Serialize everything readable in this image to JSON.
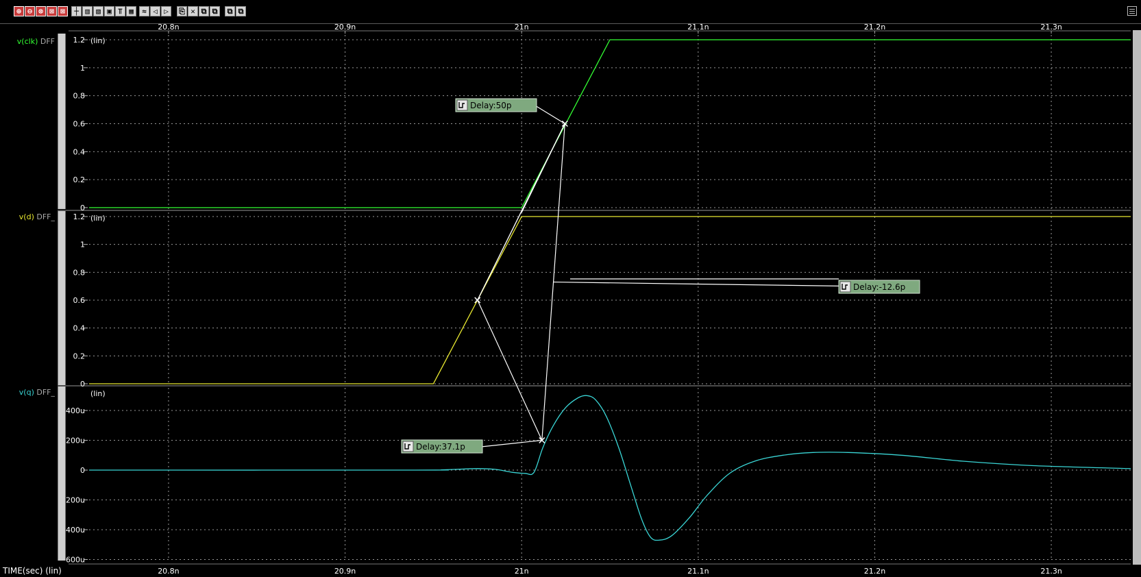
{
  "toolbar": {
    "group1": [
      "⊕",
      "⊖",
      "⊗",
      "⊠",
      "⊠"
    ],
    "group2": [
      "┼",
      "▥",
      "▧",
      "▣",
      "⫪",
      "▦"
    ],
    "group3": [
      "≈",
      "◁",
      "▷"
    ],
    "group4": [
      "⎘",
      "✕",
      "⧉",
      "⧉"
    ],
    "group5": [
      "⧉",
      "⧉"
    ]
  },
  "x_axis_label": "TIME(sec) (lin)",
  "chart_data": {
    "type": "line",
    "x_unit": "s",
    "xlim": [
      2.0755e-08,
      2.1345e-08
    ],
    "x_ticks": [
      2.08e-08,
      2.09e-08,
      2.1e-08,
      2.11e-08,
      2.12e-08,
      2.13e-08
    ],
    "x_tick_labels": [
      "20.8n",
      "20.9n",
      "21n",
      "21.1n",
      "21.2n",
      "21.3n"
    ],
    "panels": [
      {
        "id": "clk",
        "signal_label": "v(clk)",
        "signal_device": "DFF",
        "unit_label": "(lin)",
        "color": "#33ff33",
        "ylim": [
          -0.02,
          1.26
        ],
        "y_ticks": [
          0,
          0.2,
          0.4,
          0.6,
          0.8,
          1,
          1.2
        ],
        "y_tick_labels": [
          "0",
          "0.2",
          "0.4",
          "0.6",
          "0.8",
          "1",
          "1.2"
        ],
        "x": [
          2.0755e-08,
          2.1e-08,
          2.105e-08,
          2.1345e-08
        ],
        "y": [
          0,
          0,
          1.2,
          1.2
        ]
      },
      {
        "id": "d",
        "signal_label": "v(d)",
        "signal_device": "DFF_",
        "unit_label": "(lin)",
        "color": "#e8e830",
        "ylim": [
          -0.02,
          1.26
        ],
        "y_ticks": [
          0,
          0.2,
          0.4,
          0.6,
          0.8,
          1,
          1.2
        ],
        "y_tick_labels": [
          "0",
          "0.2",
          "0.4",
          "0.6",
          "0.8",
          "1",
          "1.2"
        ],
        "x": [
          2.0755e-08,
          2.095e-08,
          2.1e-08,
          2.1345e-08
        ],
        "y": [
          0,
          0,
          1.2,
          1.2
        ]
      },
      {
        "id": "q",
        "signal_label": "v(q)",
        "signal_device": "DFF_",
        "unit_label": "(lin)",
        "color": "#3ad6d6",
        "ylim": [
          -0.0006,
          0.00052
        ],
        "y_ticks": [
          -0.0006,
          -0.0004,
          -0.0002,
          0,
          0.0002,
          0.0004
        ],
        "y_tick_labels": [
          "-600u",
          "-400u",
          "-200u",
          "0",
          "200u",
          "400u"
        ],
        "x": [
          2.0755e-08,
          2.094e-08,
          2.0955e-08,
          2.0965e-08,
          2.0975e-08,
          2.0985e-08,
          2.0995e-08,
          2.1002e-08,
          2.1007e-08,
          2.1012e-08,
          2.1018e-08,
          2.1025e-08,
          2.1032e-08,
          2.1037e-08,
          2.1042e-08,
          2.1048e-08,
          2.1055e-08,
          2.1062e-08,
          2.1068e-08,
          2.1073e-08,
          2.1078e-08,
          2.1085e-08,
          2.1095e-08,
          2.1105e-08,
          2.1118e-08,
          2.1132e-08,
          2.1148e-08,
          2.1165e-08,
          2.1185e-08,
          2.1215e-08,
          2.125e-08,
          2.129e-08,
          2.1345e-08
        ],
        "y": [
          0,
          0,
          2e-06,
          6e-06,
          1e-05,
          5e-06,
          -1.5e-05,
          -2.2e-05,
          -1.5e-05,
          0.00015,
          0.0003,
          0.00042,
          0.000485,
          0.0005,
          0.00047,
          0.00036,
          0.00015,
          -0.00011,
          -0.00033,
          -0.00045,
          -0.00047,
          -0.00044,
          -0.00032,
          -0.00017,
          -2e-05,
          6e-05,
          0.0001,
          0.000118,
          0.000118,
          0.0001,
          6e-05,
          3e-05,
          1e-05
        ]
      }
    ],
    "annotations": [
      {
        "label": "Delay:50p",
        "anchor_panel": "clk",
        "anchor_x": 2.10245e-08,
        "anchor_y": 0.6
      },
      {
        "label": "Delay:-12.6p",
        "anchor_panel": "d",
        "anchor_x": 2.1018e-08,
        "anchor_y": 0.73
      },
      {
        "label": "Delay:37.1p",
        "anchor_panel": "q",
        "anchor_x": 2.10115e-08,
        "anchor_y": 0.0002
      }
    ],
    "delay_markers": [
      {
        "panel": "clk",
        "x": 2.10245e-08,
        "y": 0.6
      },
      {
        "panel": "d",
        "x": 2.0975e-08,
        "y": 0.6
      },
      {
        "panel": "q",
        "x": 2.10115e-08,
        "y": 0.0002
      }
    ],
    "grid": true
  }
}
